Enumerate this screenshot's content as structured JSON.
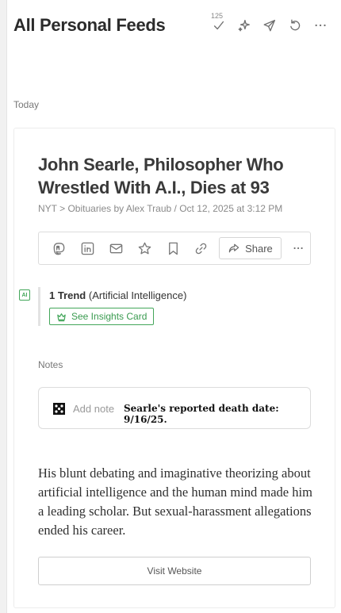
{
  "header": {
    "title": "All Personal Feeds",
    "unread_count": "125",
    "icons": [
      "mark-read-icon",
      "sparkle-icon",
      "send-icon",
      "refresh-icon",
      "more-icon"
    ]
  },
  "section": {
    "label": "Today"
  },
  "article": {
    "headline": "John Searle, Philosopher Who Wrestled With A.I., Dies at 93",
    "meta": "NYT > Obituaries by Alex Traub / Oct 12, 2025 at 3:12 PM",
    "actions": {
      "icons": [
        "mastodon-icon",
        "linkedin-icon",
        "mail-icon",
        "star-icon",
        "bookmark-icon",
        "link-icon",
        "ellipsis-icon"
      ],
      "share_label": "Share"
    },
    "trend": {
      "badge": "AI",
      "count_label": "1 Trend",
      "topic": "(Artificial Intelligence)",
      "insights_label": "See Insights Card"
    },
    "notes": {
      "label": "Notes",
      "placeholder": "Add note",
      "text": "Searle's reported death date: 9/16/25."
    },
    "summary": "His blunt debating and imaginative theorizing about artificial intelligence and the human mind made him a leading scholar. But sexual-harassment allegations ended his career.",
    "visit_label": "Visit Website"
  },
  "colors": {
    "accent_green": "#43a65a",
    "text_dark": "#2b2b2b",
    "muted": "#8a8a8a"
  }
}
